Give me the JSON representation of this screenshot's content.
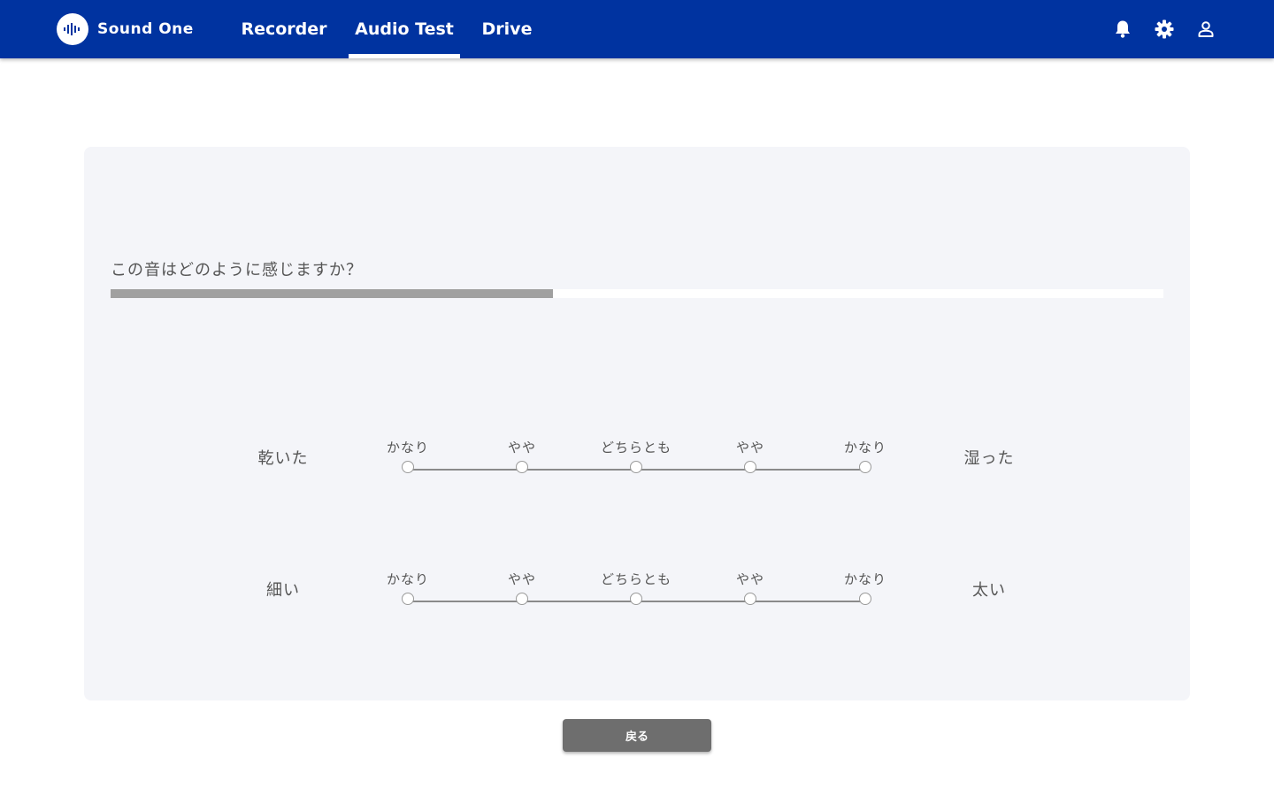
{
  "app": {
    "brand_name": "Sound One"
  },
  "nav": {
    "tabs": [
      {
        "label": "Recorder",
        "active": false
      },
      {
        "label": "Audio Test",
        "active": true
      },
      {
        "label": "Drive",
        "active": false
      }
    ]
  },
  "header_icons": [
    "bell-icon",
    "gear-icon",
    "user-icon"
  ],
  "survey": {
    "question": "この音はどのように感じますか？",
    "progress_fraction": 0.42,
    "scales": [
      {
        "left_label": "乾いた",
        "right_label": "湿った",
        "options": [
          "かなり",
          "やや",
          "どちらとも",
          "やや",
          "かなり"
        ]
      },
      {
        "left_label": "細い",
        "right_label": "太い",
        "options": [
          "かなり",
          "やや",
          "どちらとも",
          "やや",
          "かなり"
        ]
      }
    ]
  },
  "footer": {
    "back_label": "戻る"
  },
  "colors": {
    "appbar": "#0033a0",
    "panel": "#f4f5f9",
    "progress_fill": "#a0a0a0",
    "button": "#6e6e6e"
  }
}
